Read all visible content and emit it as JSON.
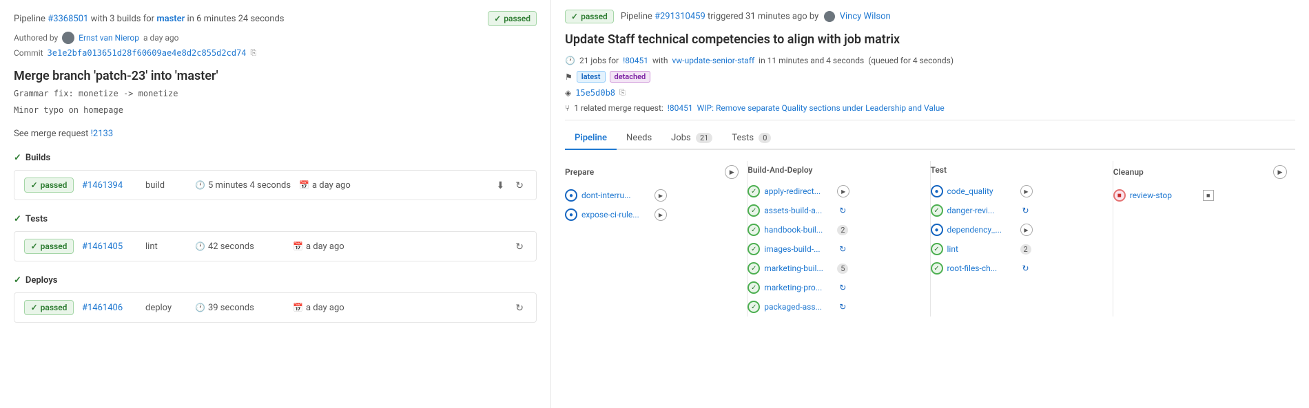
{
  "left": {
    "pipeline_text": "Pipeline",
    "pipeline_id": "#3368501",
    "pipeline_mid": "with 3 builds for",
    "branch": "master",
    "pipeline_time": "in 6 minutes 24 seconds",
    "badge_passed": "passed",
    "author_label": "Authored by",
    "author_name": "Ernst van Nierop",
    "author_time": "a day ago",
    "commit_label": "Commit",
    "commit_hash": "3e1e2bfa013651d28f60609ae4e8d2c855d2cd74",
    "merge_title": "Merge branch 'patch-23' into 'master'",
    "commit_msg1": "Grammar fix: monetize -> monetize",
    "commit_msg2": "Minor typo on homepage",
    "merge_request_text": "See merge request",
    "merge_request_id": "!2133",
    "sections": {
      "builds": {
        "label": "Builds",
        "rows": [
          {
            "id": "#1461394",
            "type": "build",
            "duration": "5 minutes 4 seconds",
            "time": "a day ago"
          }
        ]
      },
      "tests": {
        "label": "Tests",
        "rows": [
          {
            "id": "#1461405",
            "type": "lint",
            "duration": "42 seconds",
            "time": "a day ago"
          }
        ]
      },
      "deploys": {
        "label": "Deploys",
        "rows": [
          {
            "id": "#1461406",
            "type": "deploy",
            "duration": "39 seconds",
            "time": "a day ago"
          }
        ]
      }
    }
  },
  "right": {
    "badge_passed": "passed",
    "pipeline_id": "#291310459",
    "pipeline_trigger": "triggered 31 minutes ago by",
    "author_name": "Vincy Wilson",
    "title": "Update Staff technical competencies to align with job matrix",
    "jobs_count": "21 jobs for",
    "jobs_milestone": "!80451",
    "jobs_branch": "vw-update-senior-staff",
    "jobs_duration": "in 11 minutes and 4 seconds",
    "jobs_queued": "(queued for 4 seconds)",
    "tags": [
      "latest",
      "detached"
    ],
    "commit_hash": "15e5d0b8",
    "related_merge_text": "1 related merge request:",
    "related_merge_id": "!80451",
    "related_merge_title": "WIP: Remove separate Quality sections under Leadership and Value",
    "tabs": [
      {
        "label": "Pipeline",
        "count": null,
        "active": true
      },
      {
        "label": "Needs",
        "count": null,
        "active": false
      },
      {
        "label": "Jobs",
        "count": "21",
        "active": false
      },
      {
        "label": "Tests",
        "count": "0",
        "active": false
      }
    ],
    "stages": [
      {
        "name": "Prepare",
        "has_play": true,
        "has_stop": false,
        "jobs": [
          {
            "name": "dont-interru...",
            "status": "running",
            "has_play": true,
            "has_refresh": false,
            "count": null
          },
          {
            "name": "expose-ci-rule...",
            "status": "running",
            "has_play": true,
            "has_refresh": false,
            "count": null
          }
        ]
      },
      {
        "name": "Build-and-deploy",
        "has_play": false,
        "has_stop": false,
        "jobs": [
          {
            "name": "apply-redirect...",
            "status": "passed",
            "has_play": true,
            "has_refresh": false,
            "count": null
          },
          {
            "name": "assets-build-a...",
            "status": "passed",
            "has_play": false,
            "has_refresh": true,
            "count": null
          },
          {
            "name": "handbook-buil...",
            "status": "passed",
            "has_play": false,
            "has_refresh": false,
            "count": 2
          },
          {
            "name": "images-build-...",
            "status": "passed",
            "has_play": false,
            "has_refresh": true,
            "count": null
          },
          {
            "name": "marketing-buil...",
            "status": "passed",
            "has_play": false,
            "has_refresh": false,
            "count": 5
          },
          {
            "name": "marketing-pro...",
            "status": "passed",
            "has_play": false,
            "has_refresh": true,
            "count": null
          },
          {
            "name": "packaged-ass...",
            "status": "passed",
            "has_play": false,
            "has_refresh": true,
            "count": null
          }
        ]
      },
      {
        "name": "Test",
        "has_play": false,
        "has_stop": false,
        "jobs": [
          {
            "name": "code_quality",
            "status": "running",
            "has_play": true,
            "has_refresh": false,
            "count": null
          },
          {
            "name": "danger-revi...",
            "status": "passed",
            "has_play": false,
            "has_refresh": true,
            "count": null
          },
          {
            "name": "dependency_...",
            "status": "running",
            "has_play": true,
            "has_refresh": false,
            "count": null
          },
          {
            "name": "lint",
            "status": "passed",
            "has_play": false,
            "has_refresh": false,
            "count": 2
          },
          {
            "name": "root-files-ch...",
            "status": "passed",
            "has_play": false,
            "has_refresh": true,
            "count": null
          }
        ]
      },
      {
        "name": "Cleanup",
        "has_play": false,
        "has_stop": true,
        "jobs": [
          {
            "name": "review-stop",
            "status": "stopped",
            "has_play": false,
            "has_refresh": false,
            "has_square": true,
            "count": null
          }
        ]
      }
    ]
  }
}
